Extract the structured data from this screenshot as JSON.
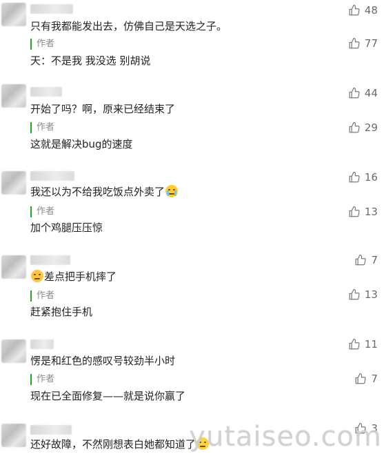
{
  "comments": [
    {
      "text": "只有我都能发出去，仿佛自己是天选之子。",
      "likes": "48",
      "reply_label": "作者",
      "reply_text": "天：不是我 我没选 别胡说",
      "reply_likes": "77"
    },
    {
      "text": "开始了吗？啊，原来已经结束了",
      "likes": "44",
      "reply_label": "作者",
      "reply_text": "这就是解决bug的速度",
      "reply_likes": "29"
    },
    {
      "text": "我还以为不给我吃饭点外卖了",
      "likes": "16",
      "reply_label": "作者",
      "reply_text": "加个鸡腿压压惊",
      "reply_likes": "13",
      "emoji": "crying-face-emoji"
    },
    {
      "text": "差点把手机摔了",
      "likes": "7",
      "reply_label": "作者",
      "reply_text": "赶紧抱住手机",
      "reply_likes": "13",
      "emoji": "unamused-face-emoji"
    },
    {
      "text": "愣是和红色的感叹号较劲半小时",
      "likes": "11",
      "reply_label": "作者",
      "reply_text": "现在已全面修复——就是说你赢了",
      "reply_likes": "7"
    },
    {
      "text": "还好故障，不然刚想表白她都知道了",
      "likes": "3",
      "emoji": "thinking-face-emoji"
    }
  ],
  "watermark": "yutaiseo.com",
  "icons": {
    "like": "thumbs-up-icon"
  },
  "colors": {
    "author_bar": "#1aad19",
    "muted": "#8a8a8a"
  }
}
